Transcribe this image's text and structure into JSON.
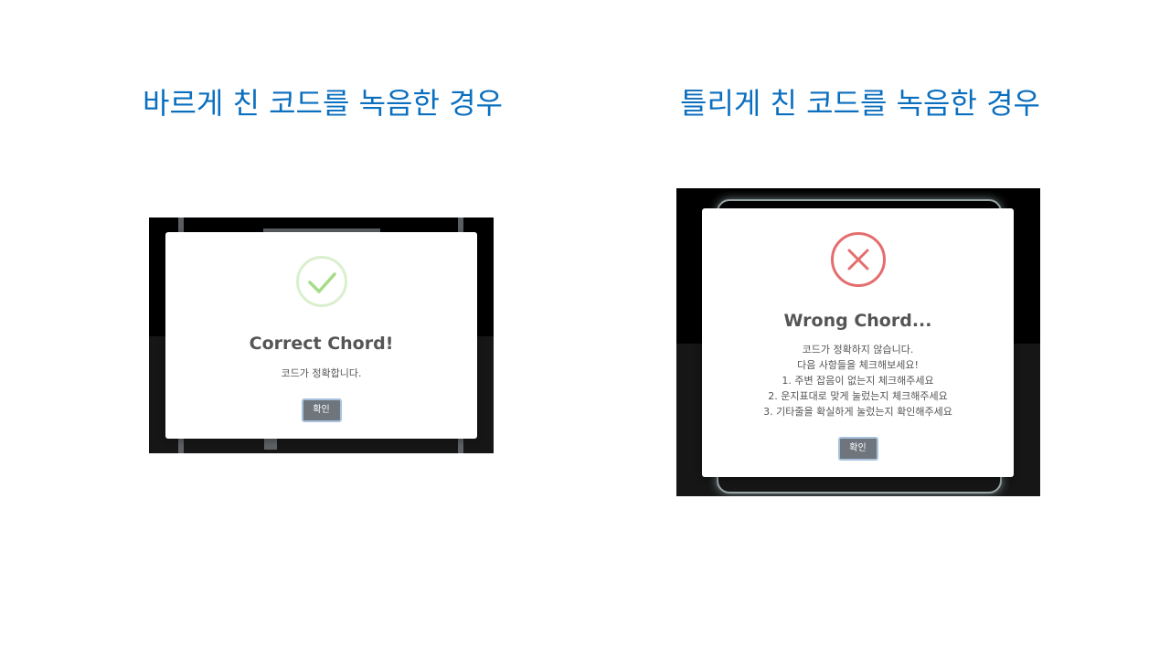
{
  "left": {
    "heading": "바르게 친 코드를 녹음한 경우",
    "modal": {
      "icon": "check-icon",
      "title": "Correct Chord!",
      "message_lines": [
        "코드가 정확합니다."
      ],
      "confirm_label": "확인"
    }
  },
  "right": {
    "heading": "틀리게 친 코드를 녹음한 경우",
    "modal": {
      "icon": "x-icon",
      "title": "Wrong Chord...",
      "message_lines": [
        "코드가 정확하지 않습니다.",
        "다음 사항들을 체크해보세요!",
        "1. 주변 잡음이 없는지 체크해주세요",
        "2. 운지표대로 맞게 눌렀는지 체크해주세요",
        "3. 기타줄을 확실하게 눌렀는지 확인해주세요"
      ],
      "confirm_label": "확인"
    }
  },
  "colors": {
    "heading": "#0b6fbf",
    "success_ring": "#d9efcd",
    "success_check": "#a5dc86",
    "error_ring": "#e56d6d",
    "button": "#6e757c"
  }
}
